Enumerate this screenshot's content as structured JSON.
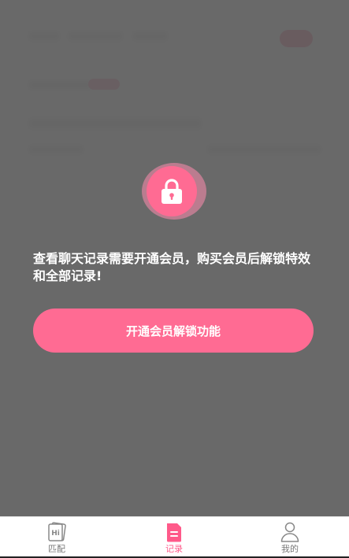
{
  "lock": {
    "icon": "lock-icon"
  },
  "message": "查看聊天记录需要开通会员，购买会员后解锁特效和全部记录!",
  "cta_label": "开通会员解锁功能",
  "tabbar": {
    "items": [
      {
        "label": "匹配",
        "icon": "hi-card-icon",
        "active": false
      },
      {
        "label": "记录",
        "icon": "document-icon",
        "active": true
      },
      {
        "label": "我的",
        "icon": "person-icon",
        "active": false
      }
    ]
  },
  "colors": {
    "accent": "#ff6b93",
    "overlay": "#666666",
    "tab_inactive": "#777777"
  }
}
